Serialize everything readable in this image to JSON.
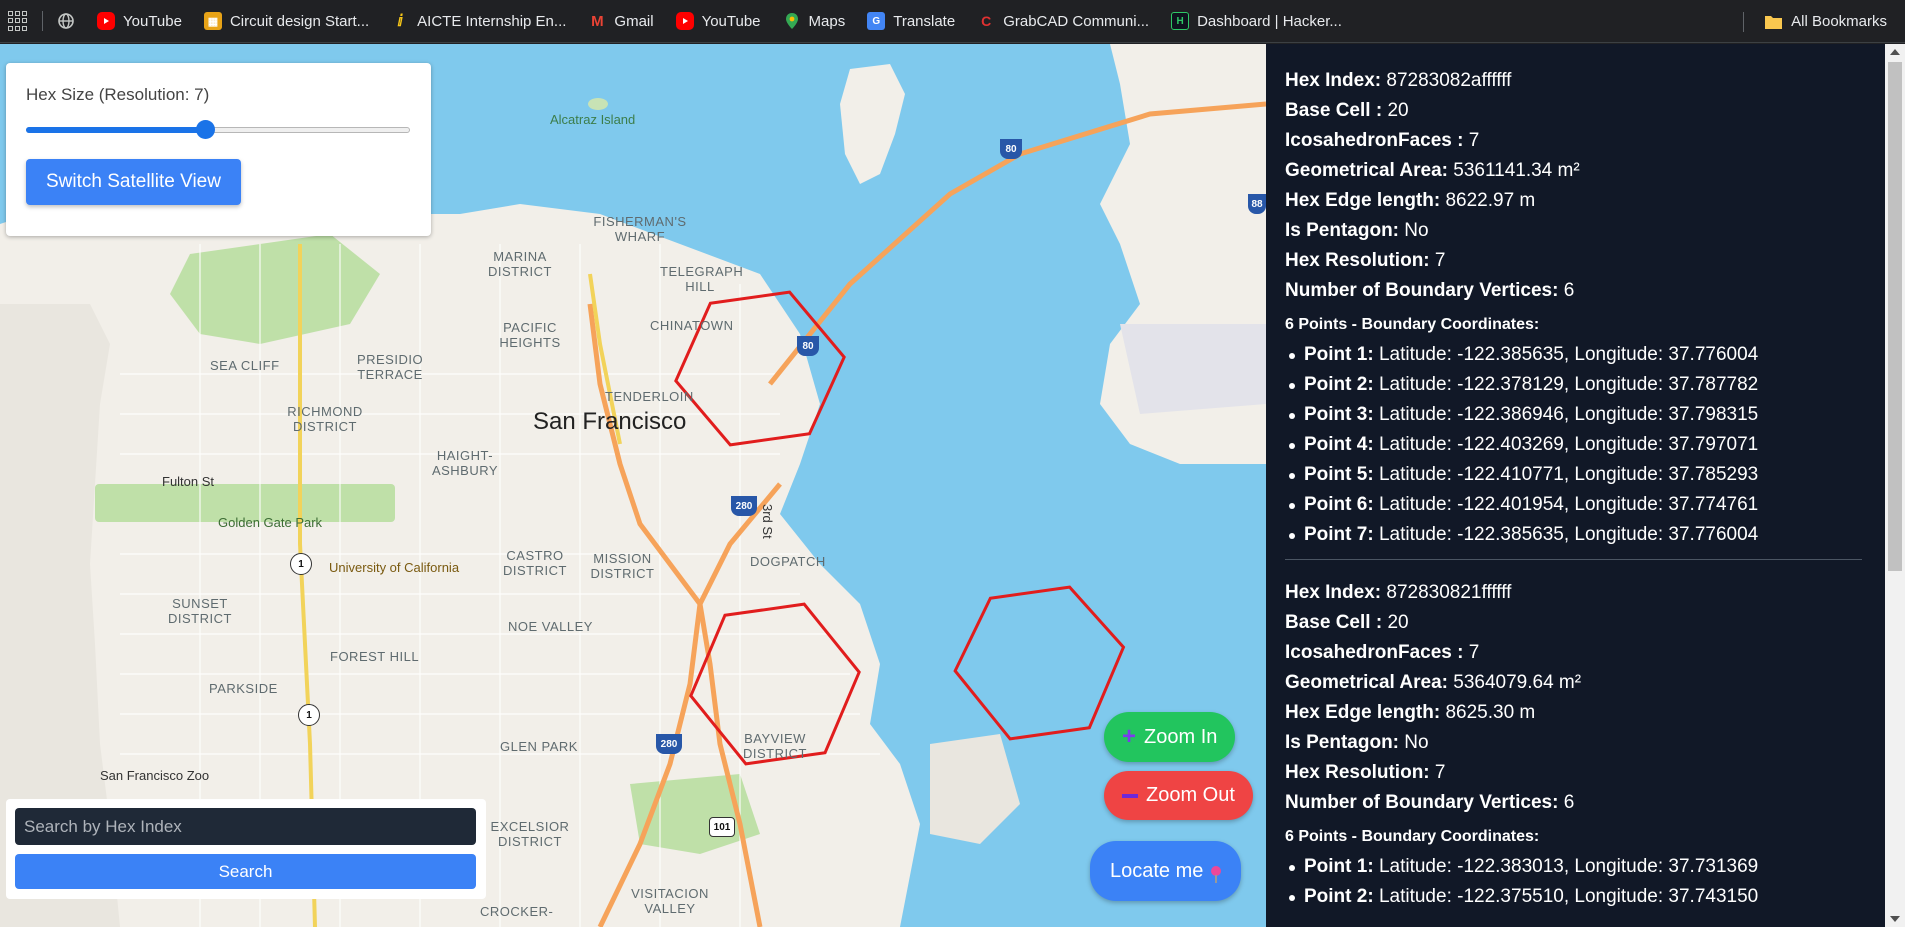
{
  "bookmarks": {
    "items": [
      {
        "label": "YouTube",
        "icon": "youtube-icon",
        "color": "#ff0000"
      },
      {
        "label": "Circuit design Start...",
        "icon": "tinkercad-icon",
        "color": "#e8a317"
      },
      {
        "label": "AICTE Internship En...",
        "icon": "aicte-icon",
        "color": "#f5c518"
      },
      {
        "label": "Gmail",
        "icon": "gmail-icon",
        "color": "#ea4335"
      },
      {
        "label": "YouTube",
        "icon": "youtube-icon",
        "color": "#ff0000"
      },
      {
        "label": "Maps",
        "icon": "maps-icon",
        "color": "#34a853"
      },
      {
        "label": "Translate",
        "icon": "translate-icon",
        "color": "#4285f4"
      },
      {
        "label": "GrabCAD Communi...",
        "icon": "grabcad-icon",
        "color": "#e03131"
      },
      {
        "label": "Dashboard | Hacker...",
        "icon": "hackerrank-icon",
        "color": "#2ec866"
      }
    ],
    "all_bookmarks": "All Bookmarks"
  },
  "controls": {
    "hex_size_label": "Hex Size (Resolution: 7)",
    "resolution": 7,
    "resolution_min": 0,
    "resolution_max": 15,
    "switch_view_label": "Switch Satellite View"
  },
  "search": {
    "placeholder": "Search by Hex Index",
    "button_label": "Search"
  },
  "map": {
    "city_label": "San Francisco",
    "labels": {
      "alcatraz": "Alcatraz Island",
      "fishermans_wharf": "FISHERMAN'S WHARF",
      "marina": "MARINA DISTRICT",
      "telegraph_hill": "TELEGRAPH HILL",
      "pacific_heights": "PACIFIC HEIGHTS",
      "chinatown": "CHINATOWN",
      "presidio": "PRESIDIO TERRACE",
      "sea_cliff": "SEA CLIFF",
      "tenderloin": "TENDERLOIN",
      "richmond": "RICHMOND DISTRICT",
      "fulton": "Fulton St",
      "haight": "HAIGHT-ASHBURY",
      "golden_gate_park": "Golden Gate Park",
      "ucsf": "University of California",
      "castro": "CASTRO DISTRICT",
      "mission": "MISSION DISTRICT",
      "dogpatch": "DOGPATCH",
      "third_st": "3rd St",
      "sunset": "SUNSET DISTRICT",
      "noe_valley": "NOE VALLEY",
      "forest_hill": "FOREST HILL",
      "parkside": "PARKSIDE",
      "glen_park": "GLEN PARK",
      "bayview": "BAYVIEW DISTRICT",
      "sf_zoo": "San Francisco Zoo",
      "excelsior": "EXCELSIOR DISTRICT",
      "crocker": "CROCKER-",
      "visitacion": "VISITACION VALLEY"
    },
    "shields": {
      "i80_a": "80",
      "i80_b": "80",
      "i80_c": "88",
      "i280_a": "280",
      "i280_b": "280",
      "us101": "101",
      "ca1_a": "1",
      "ca1_b": "1"
    },
    "hex_color": "#e11d1d"
  },
  "buttons": {
    "zoom_in": "Zoom In",
    "zoom_out": "Zoom Out",
    "locate": "Locate me"
  },
  "labels": {
    "hex_index": "Hex Index:",
    "base_cell": "Base Cell :",
    "icosahedron": "IcosahedronFaces :",
    "area": "Geometrical Area:",
    "edge": "Hex Edge length:",
    "pentagon": "Is Pentagon:",
    "resolution": "Hex Resolution:",
    "vertices": "Number of Boundary Vertices:",
    "points_title": "6 Points - Boundary Coordinates:"
  },
  "hexes": [
    {
      "hex_index": "87283082affffff",
      "base_cell": "20",
      "icosahedron_faces": "7",
      "area": "5361141.34 m²",
      "edge_length": "8622.97 m",
      "is_pentagon": "No",
      "resolution": "7",
      "boundary_vertices": "6",
      "points": [
        {
          "label": "Point 1:",
          "text": "Latitude: -122.385635, Longitude: 37.776004"
        },
        {
          "label": "Point 2:",
          "text": "Latitude: -122.378129, Longitude: 37.787782"
        },
        {
          "label": "Point 3:",
          "text": "Latitude: -122.386946, Longitude: 37.798315"
        },
        {
          "label": "Point 4:",
          "text": "Latitude: -122.403269, Longitude: 37.797071"
        },
        {
          "label": "Point 5:",
          "text": "Latitude: -122.410771, Longitude: 37.785293"
        },
        {
          "label": "Point 6:",
          "text": "Latitude: -122.401954, Longitude: 37.774761"
        },
        {
          "label": "Point 7:",
          "text": "Latitude: -122.385635, Longitude: 37.776004"
        }
      ]
    },
    {
      "hex_index": "872830821ffffff",
      "base_cell": "20",
      "icosahedron_faces": "7",
      "area": "5364079.64 m²",
      "edge_length": "8625.30 m",
      "is_pentagon": "No",
      "resolution": "7",
      "boundary_vertices": "6",
      "points": [
        {
          "label": "Point 1:",
          "text": "Latitude: -122.383013, Longitude: 37.731369"
        },
        {
          "label": "Point 2:",
          "text": "Latitude: -122.375510, Longitude: 37.743150"
        }
      ]
    }
  ]
}
